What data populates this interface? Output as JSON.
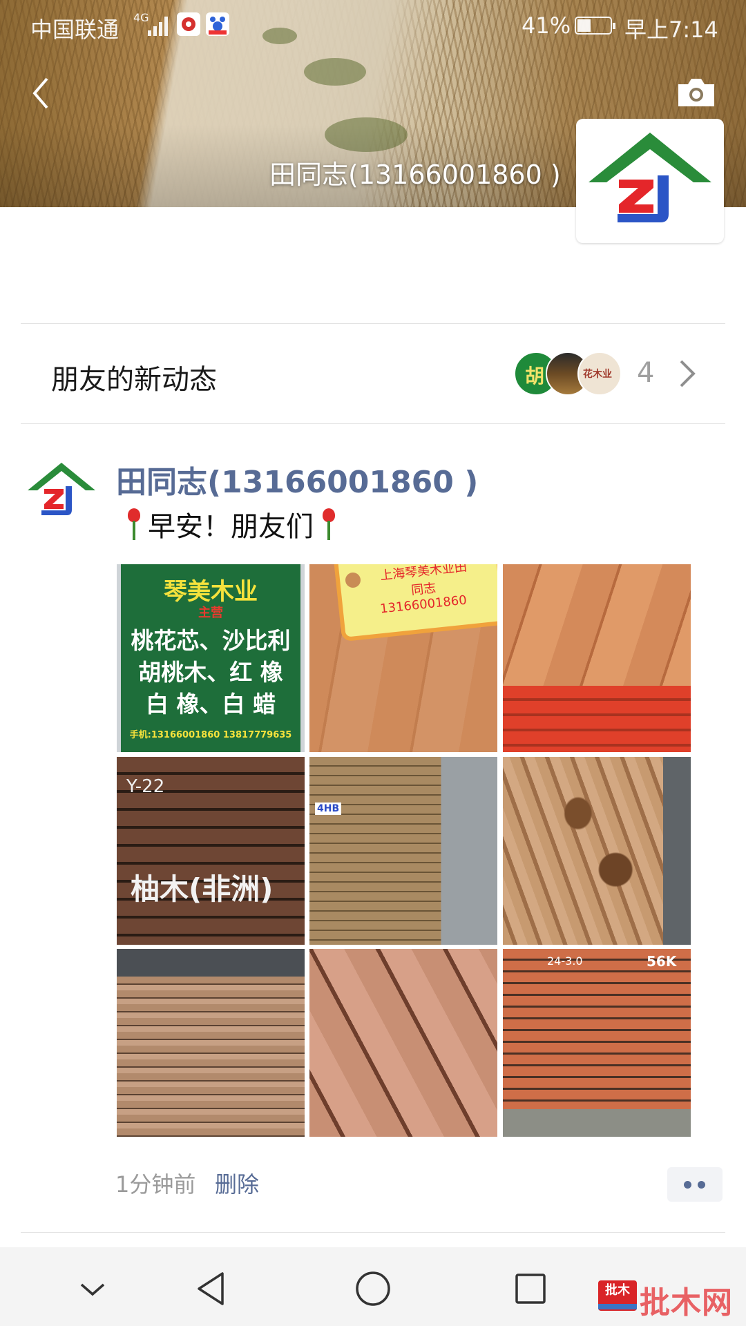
{
  "status_bar": {
    "carrier": "中国联通",
    "network": "4G",
    "battery_percent": "41%",
    "battery_level": 0.41,
    "time": "早上7:14",
    "app_icons": [
      "weibo-icon",
      "baidu-icon"
    ]
  },
  "header": {
    "back_icon": "chevron-left-icon",
    "camera_icon": "camera-icon",
    "profile_name": "田同志(13166001860 )"
  },
  "friends_updates": {
    "label": "朋友的新动态",
    "count": "4",
    "avatar_labels": [
      "胡",
      "花木业"
    ]
  },
  "post": {
    "author": "田同志(13166001860 )",
    "text": "早安！朋友们",
    "time": "1分钟前",
    "delete_label": "删除",
    "photos": {
      "p1": {
        "title": "琴美木业",
        "sub": "主营",
        "line1": "桃花芯、沙比利",
        "line2": "胡桃木、红  橡",
        "line3": "白  橡、白  蜡",
        "phones": "手机:13166001860  13817779635"
      },
      "p2": {
        "line1": "上海琴美木业田",
        "line2": "同志",
        "line3": "13166001860"
      },
      "p4": {
        "text": "柚木(非洲)",
        "mark": "Y-22"
      },
      "p5": {
        "tag": "4HB"
      },
      "p9": {
        "mark1": "24-3.0",
        "mark2": "56K"
      }
    }
  },
  "watermark": {
    "logo": "批木",
    "text": "批木网"
  },
  "colors": {
    "link": "#576b95",
    "plank_edge": "#e0402a",
    "sign_green": "#1e6e3a"
  }
}
